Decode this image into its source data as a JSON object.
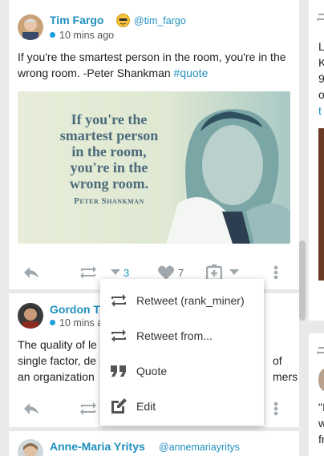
{
  "tweets": [
    {
      "name": "Tim Fargo",
      "handle": "@tim_fargo",
      "time": "10 mins ago",
      "text": "If you're the smartest person in the room, you're in the wrong room. -Peter Shankman",
      "hashtag": "#quote",
      "retweet_count": "3",
      "like_count": "7",
      "image": {
        "quote_line1": "If you're the",
        "quote_line2": "smartest person",
        "quote_line3": "in the room,",
        "quote_line4": "you're in the",
        "quote_line5": "wrong room.",
        "author": "Peter Shankman"
      }
    },
    {
      "name": "Gordon T",
      "time": "10 mins a",
      "text_line1": "The quality of le",
      "text_line2": "single factor, de",
      "text_line2_end": "of",
      "text_line3": "an organization",
      "text_line3_end": "mers"
    },
    {
      "name": "Anne-Maria Yritys",
      "handle": "@annemariayritys"
    }
  ],
  "menu": {
    "items": [
      {
        "label": "Retweet (rank_miner)",
        "icon": "retweet-icon"
      },
      {
        "label": "Retweet from...",
        "icon": "retweet-icon"
      },
      {
        "label": "Quote",
        "icon": "quote-icon"
      },
      {
        "label": "Edit",
        "icon": "edit-icon"
      }
    ]
  },
  "right_column": {
    "lines": [
      "L",
      "K",
      "9",
      "o",
      "t"
    ],
    "bottom_lines": [
      "\"I",
      "w",
      "fr"
    ]
  },
  "colors": {
    "link": "#1f8fbf",
    "icon": "#a0a8ad",
    "background": "#e9e9e9"
  }
}
